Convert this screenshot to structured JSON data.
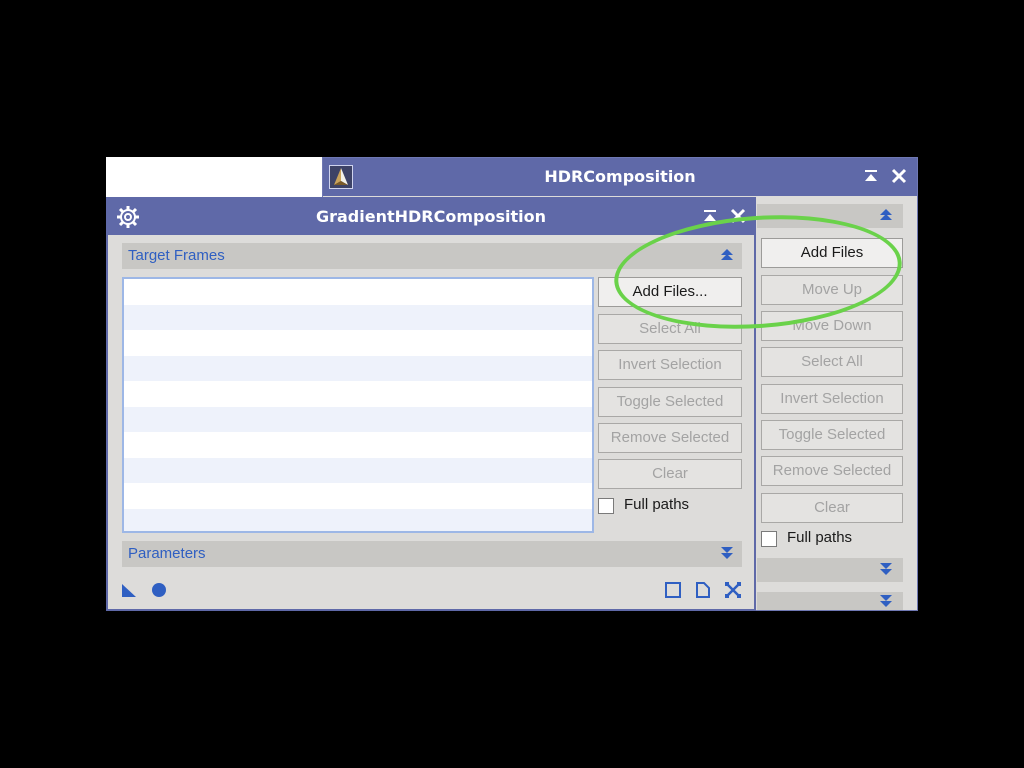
{
  "back_window": {
    "title": "HDRComposition",
    "buttons": [
      {
        "label": "Add Files",
        "enabled": true
      },
      {
        "label": "Move Up",
        "enabled": false
      },
      {
        "label": "Move Down",
        "enabled": false
      },
      {
        "label": "Select All",
        "enabled": false
      },
      {
        "label": "Invert Selection",
        "enabled": false
      },
      {
        "label": "Toggle Selected",
        "enabled": false
      },
      {
        "label": "Remove Selected",
        "enabled": false
      },
      {
        "label": "Clear",
        "enabled": false
      }
    ],
    "full_paths_label": "Full paths"
  },
  "front_window": {
    "title": "GradientHDRComposition",
    "sections": {
      "target_frames": "Target Frames",
      "parameters": "Parameters"
    },
    "buttons": [
      {
        "label": "Add Files...",
        "enabled": true
      },
      {
        "label": "Select All",
        "enabled": false
      },
      {
        "label": "Invert Selection",
        "enabled": false
      },
      {
        "label": "Toggle Selected",
        "enabled": false
      },
      {
        "label": "Remove Selected",
        "enabled": false
      },
      {
        "label": "Clear",
        "enabled": false
      }
    ],
    "full_paths_label": "Full paths",
    "full_paths_checked": false
  },
  "colors": {
    "titlebar": "#5f69a8",
    "section_text": "#2f5fc2",
    "highlight": "#6ad24a"
  }
}
